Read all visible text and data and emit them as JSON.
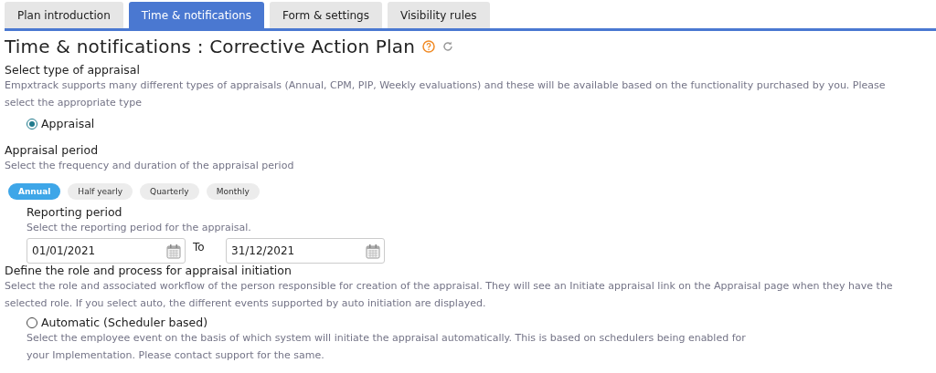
{
  "tabs": [
    {
      "label": "Plan introduction",
      "selected": false
    },
    {
      "label": "Time & notifications",
      "selected": true
    },
    {
      "label": "Form & settings",
      "selected": false
    },
    {
      "label": "Visibility rules",
      "selected": false
    }
  ],
  "title": "Time & notifications : Corrective Action Plan",
  "appraisal_type": {
    "heading": "Select type of appraisal",
    "description": "Empxtrack supports many different types of appraisals (Annual, CPM, PIP, Weekly evaluations) and these will be available based on the functionality purchased by you. Please select the appropriate type",
    "options": [
      {
        "label": "Appraisal",
        "selected": true
      }
    ]
  },
  "appraisal_period": {
    "heading": "Appraisal period",
    "description": "Select the frequency and duration of the appraisal period",
    "frequencies": [
      {
        "label": "Annual",
        "selected": true
      },
      {
        "label": "Half yearly",
        "selected": false
      },
      {
        "label": "Quarterly",
        "selected": false
      },
      {
        "label": "Monthly",
        "selected": false
      }
    ],
    "reporting_period": {
      "heading": "Reporting period",
      "description": "Select the reporting period for the appraisal.",
      "start": "01/01/2021",
      "separator": "To",
      "end": "31/12/2021"
    }
  },
  "initiation": {
    "heading": "Define the role and process for appraisal initiation",
    "description": "Select the role and associated workflow of the person responsible for creation of the appraisal. They will see an Initiate appraisal link on the Appraisal page when they have the selected role. If you select auto, the different events supported by auto initiation are displayed.",
    "options": [
      {
        "label": "Automatic (Scheduler based)",
        "selected": false,
        "description": "Select the employee event on the basis of which system will initiate the appraisal automatically. This is based on schedulers being enabled for your Implementation. Please contact support for the same."
      }
    ]
  }
}
